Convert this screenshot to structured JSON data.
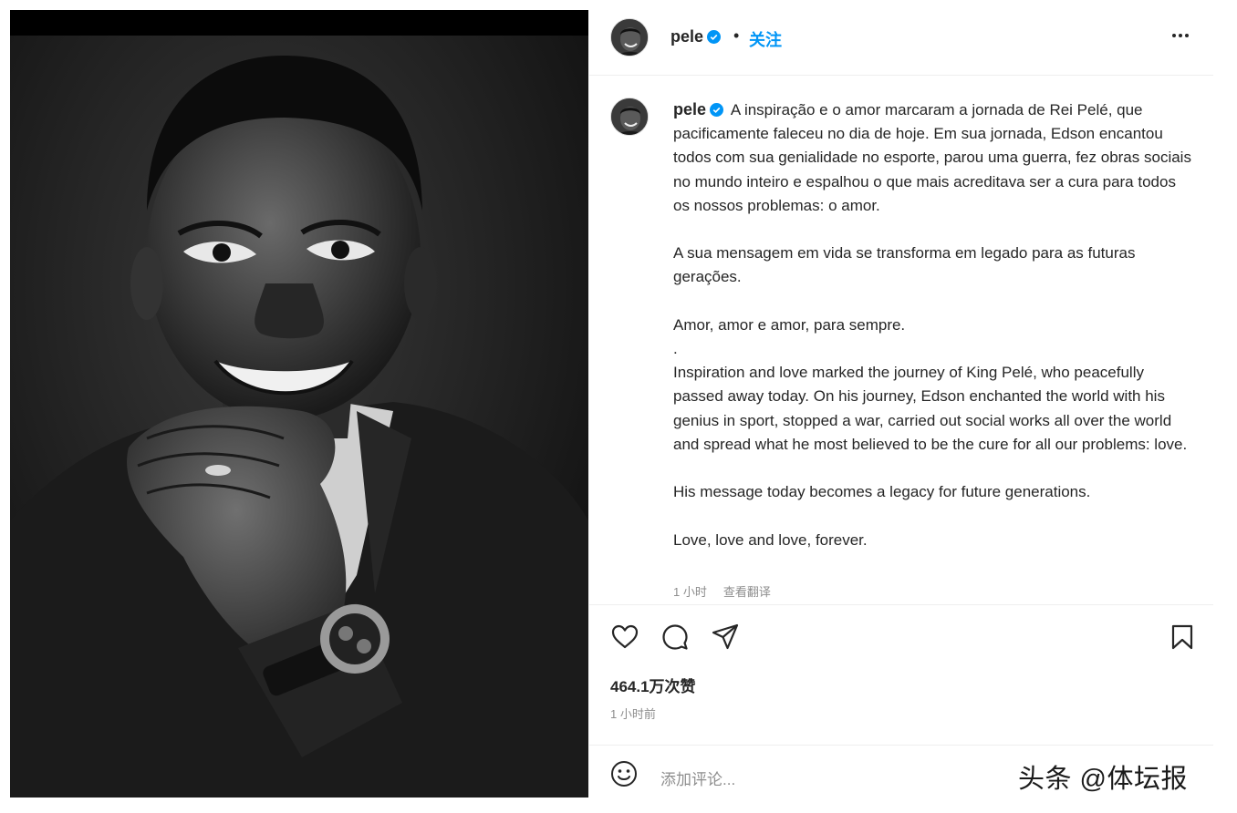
{
  "post": {
    "username": "pele",
    "follow_label": "关注",
    "separator": "•",
    "caption": {
      "pt_intro": "A inspiração e o amor marcaram a jornada de Rei Pelé, que pacificamente faleceu no dia de hoje. Em sua jornada, Edson encantou todos com sua genialidade no esporte, parou uma guerra, fez obras sociais no mundo inteiro e espalhou o que mais acreditava ser a cura para todos os nossos problemas: o amor.",
      "pt_message": "A sua mensagem em vida se transforma em legado para as futuras gerações.",
      "pt_love": "Amor, amor e amor, para sempre.",
      "separator_dot": ".",
      "en_intro": "Inspiration and love marked the journey of King Pelé, who peacefully passed away today. On his journey, Edson enchanted the world with his genius in sport, stopped a war, carried out social works all over the world and spread what he most believed to be the cure for all our problems: love.",
      "en_message": "His message today becomes a legacy for future generations.",
      "en_love": "Love, love and love, forever."
    },
    "caption_time": "1 小时",
    "see_translation": "查看翻译",
    "likes": "464.1万次赞",
    "posted_time": "1 小时前",
    "comment_placeholder": "添加评论..."
  },
  "icons": {
    "verified": "verified-badge-icon",
    "more": "more-options-icon",
    "like": "heart-icon",
    "comment": "comment-bubble-icon",
    "share": "send-icon",
    "save": "bookmark-icon",
    "emoji": "emoji-icon"
  },
  "colors": {
    "accent": "#0095f6",
    "text": "#262626",
    "secondary": "#8e8e8e",
    "divider": "#efefef"
  },
  "watermark": "头条 @体坛报"
}
